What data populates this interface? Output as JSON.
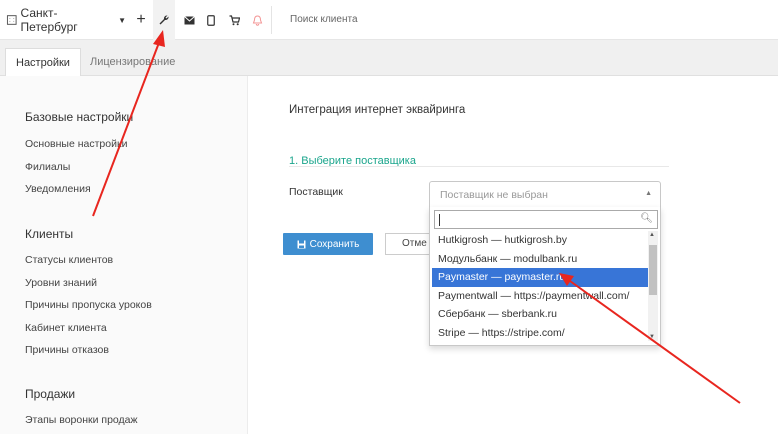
{
  "topbar": {
    "city": "Санкт-Петербург",
    "search_placeholder": "Поиск клиента"
  },
  "tabs": [
    {
      "label": "Настройки",
      "active": true
    },
    {
      "label": "Лицензирование",
      "active": false
    }
  ],
  "sidebar": {
    "sections": [
      {
        "heading": "Базовые настройки",
        "items": [
          "Основные настройки",
          "Филиалы",
          "Уведомления"
        ]
      },
      {
        "heading": "Клиенты",
        "items": [
          "Статусы клиентов",
          "Уровни знаний",
          "Причины пропуска уроков",
          "Кабинет клиента",
          "Причины отказов"
        ]
      },
      {
        "heading": "Продажи",
        "items": [
          "Этапы воронки продаж"
        ]
      }
    ]
  },
  "main": {
    "title": "Интеграция интернет эквайринга",
    "step_title": "1. Выберите поставщика",
    "provider_label": "Поставщик",
    "select_placeholder": "Поставщик не выбран",
    "options": [
      "Hutkigrosh — hutkigrosh.by",
      "Модульбанк — modulbank.ru",
      "Paymaster — paymaster.ru",
      "Paymentwall — https://paymentwall.com/",
      "Сбербанк — sberbank.ru",
      "Stripe — https://stripe.com/"
    ],
    "highlighted_option": "Paymaster — paymaster.ru",
    "save_label": "Сохранить",
    "cancel_label": "Отме"
  },
  "colors": {
    "accent_green": "#1aa58c",
    "highlight_blue": "#3875d7",
    "save_blue": "#3e8ed0",
    "arrow_red": "#e8261f"
  }
}
